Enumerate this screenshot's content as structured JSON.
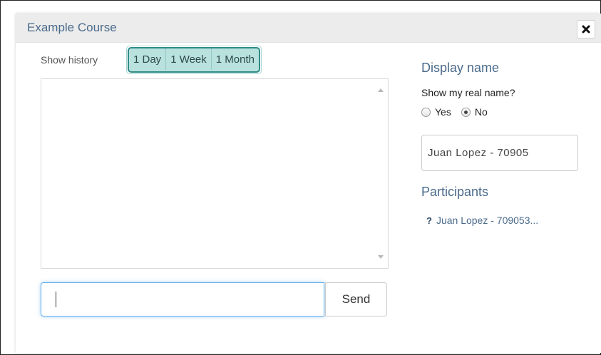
{
  "dialog": {
    "title": "Example Course",
    "close_label": "✖"
  },
  "history": {
    "label": "Show history",
    "options": [
      "1 Day",
      "1 Week",
      "1 Month"
    ]
  },
  "chat": {
    "input_value": "",
    "input_placeholder": "",
    "send_label": "Send"
  },
  "display_name": {
    "heading": "Display name",
    "question": "Show my real name?",
    "options": [
      "Yes",
      "No"
    ],
    "selected": "No",
    "name_value": "Juan Lopez - 70905"
  },
  "participants": {
    "heading": "Participants",
    "items": [
      {
        "status_icon": "?",
        "name": "Juan Lopez - 709053..."
      }
    ]
  },
  "colors": {
    "accent_teal": "#2e8b87",
    "title_blue": "#4b6b8c",
    "focus_blue": "#66afe9"
  }
}
